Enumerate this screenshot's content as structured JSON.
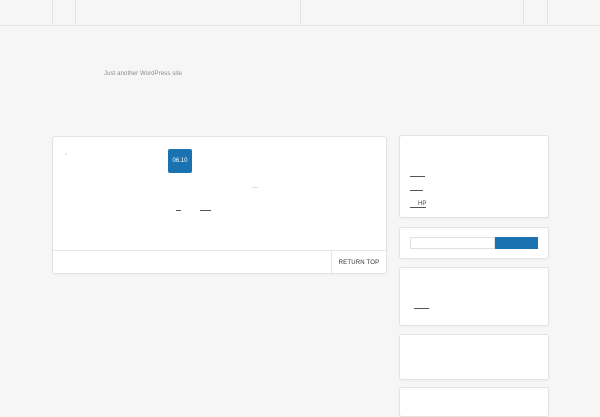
{
  "site": {
    "tagline": "Just another WordPress site"
  },
  "post": {
    "date": "06.10",
    "mark": "°",
    "ellipsis": "…"
  },
  "footer": {
    "return_top_label": "RETURN TOP"
  },
  "sidebar": {
    "links": [
      "",
      "",
      "HP"
    ],
    "search": {
      "placeholder": "",
      "button_label": ""
    },
    "recent_link": ""
  },
  "colors": {
    "accent": "#1a73b0",
    "background": "#f6f6f6",
    "card": "#ffffff",
    "border": "#e2e2e2"
  }
}
